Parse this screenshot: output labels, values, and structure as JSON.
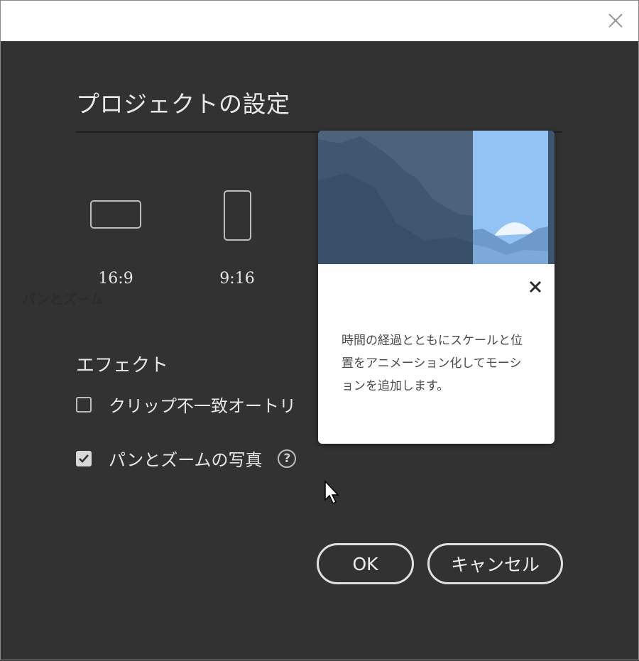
{
  "window": {
    "close_icon": "close-icon"
  },
  "dialog": {
    "title": "プロジェクトの設定",
    "ratios": [
      {
        "label": "16:9"
      },
      {
        "label": "9:16"
      }
    ],
    "effects_label": "エフェクト",
    "options": {
      "auto_reframe": {
        "label": "クリップ不一致オートリ",
        "checked": false
      },
      "pan_zoom": {
        "label": "パンとズームの写真",
        "checked": true
      }
    },
    "ok_label": "OK",
    "cancel_label": "キャンセル"
  },
  "popover": {
    "title": "パンとズーム",
    "body": "時間の経過とともにスケールと位置をアニメーション化してモーションを追加します。"
  },
  "colors": {
    "background": "#323232",
    "text": "#e6e6e6",
    "popover_bg": "#ffffff"
  }
}
